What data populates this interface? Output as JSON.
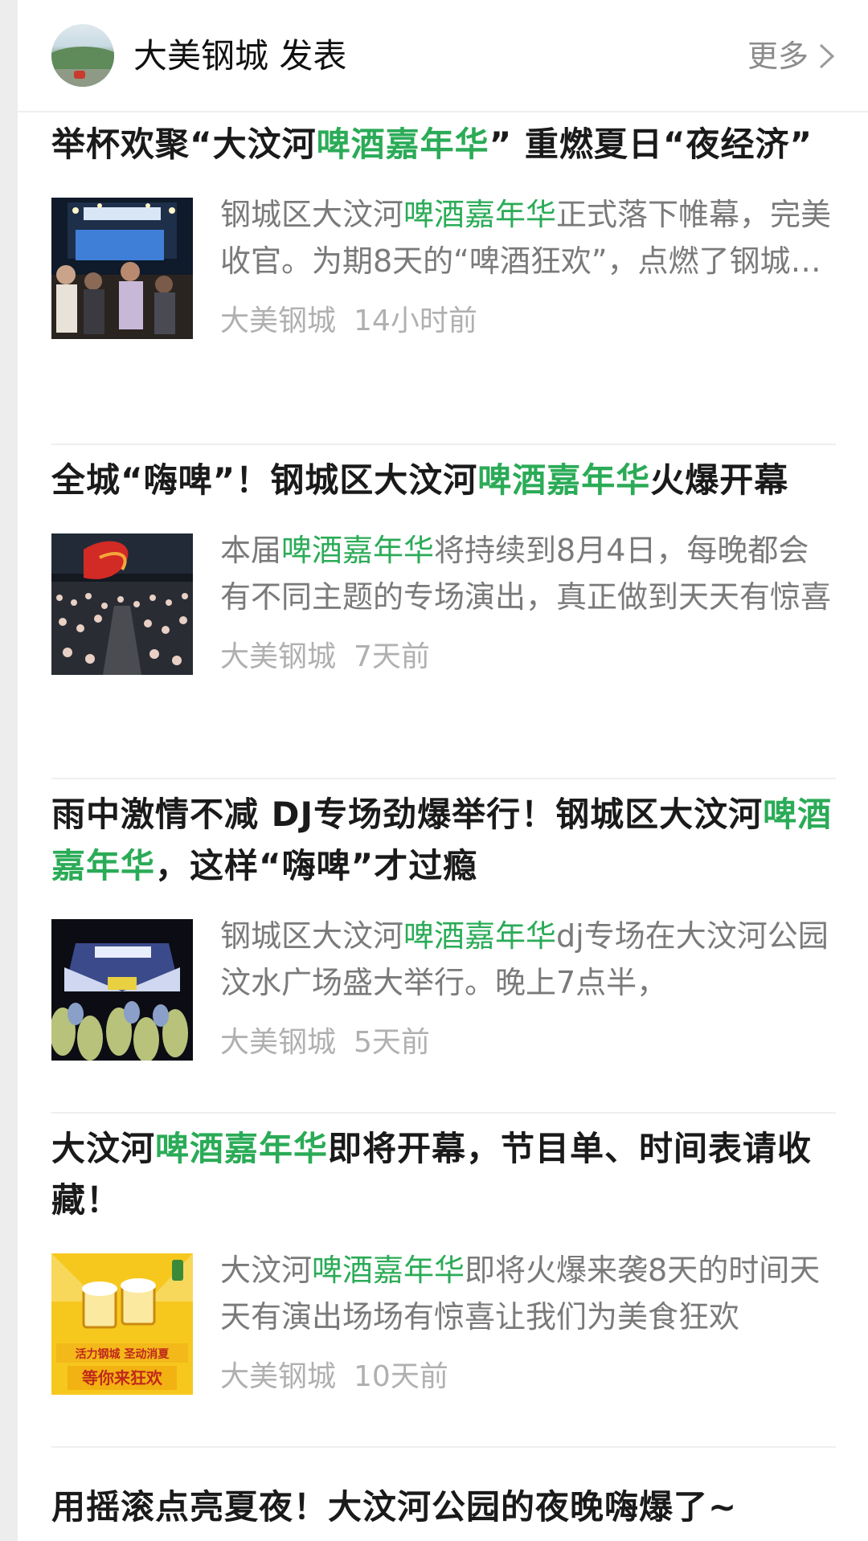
{
  "header": {
    "account_name": "大美钢城 发表",
    "more_label": "更多",
    "more_icon": "chevron-right-icon"
  },
  "accent_color": "#2bab57",
  "articles": [
    {
      "title_parts": [
        "举杯欢聚“大汶河",
        "啤酒嘉年华",
        "” 重燃夏日“夜经济”"
      ],
      "digest_parts": [
        "钢城区大汶河",
        "啤酒嘉年华",
        "正式落下帷幕，完美收官。为期8天的“啤酒狂欢”，点燃了钢城的夏夜"
      ],
      "source": "大美钢城",
      "time": "14小时前"
    },
    {
      "title_parts": [
        "全城“嗨啤”！钢城区大汶河",
        "啤酒嘉年华",
        "火爆开幕"
      ],
      "digest_parts": [
        "本届",
        "啤酒嘉年华",
        "将持续到8月4日，每晚都会有不同主题的专场演出，真正做到天天有惊喜"
      ],
      "source": "大美钢城",
      "time": "7天前"
    },
    {
      "title_parts": [
        "雨中激情不减 DJ专场劲爆举行！钢城区大汶河",
        "啤酒嘉年华",
        "，这样“嗨啤”才过瘾"
      ],
      "digest_parts": [
        "钢城区大汶河",
        "啤酒嘉年华",
        "dj专场在大汶河公园汶水广场盛大举行。晚上7点半，"
      ],
      "source": "大美钢城",
      "time": "5天前"
    },
    {
      "title_parts": [
        "大汶河",
        "啤酒嘉年华",
        "即将开幕，节目单、时间表请收藏！"
      ],
      "digest_parts": [
        "大汶河",
        "啤酒嘉年华",
        "即将火爆来袭8天的时间天天有演出场场有惊喜让我们为美食狂欢"
      ],
      "source": "大美钢城",
      "time": "10天前",
      "thumb_text": [
        "活力钢城 圣动消夏",
        "等你来狂欢"
      ]
    },
    {
      "title_parts": [
        "用摇滚点亮夏夜！大汶河公园的夜晚嗨爆了~",
        "",
        ""
      ]
    }
  ]
}
